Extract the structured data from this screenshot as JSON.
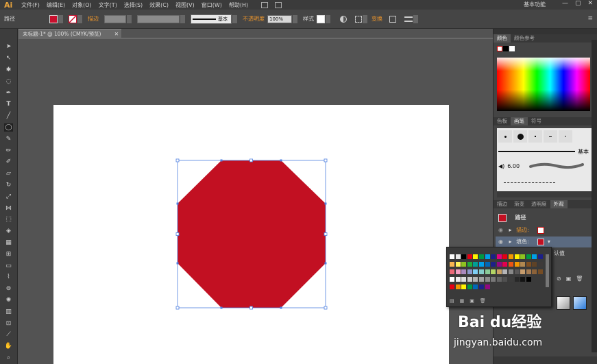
{
  "app": {
    "logo": "Ai",
    "workspace": "基本功能"
  },
  "menu": [
    "文件(F)",
    "编辑(E)",
    "对象(O)",
    "文字(T)",
    "选择(S)",
    "效果(C)",
    "视图(V)",
    "窗口(W)",
    "帮助(H)"
  ],
  "window_controls": [
    "—",
    "▢",
    "✕"
  ],
  "control_bar": {
    "selection_label": "路径",
    "stroke_label": "描边",
    "stroke_style": "基本",
    "opacity_label": "不透明度",
    "opacity_value": "100%",
    "style_label": "样式",
    "transform_label": "变换",
    "fill_color": "#c8102e"
  },
  "document": {
    "tab_title": "未标题-1* @ 100% (CMYK/预览)",
    "tab_close": "✕",
    "shape_fill": "#c21022",
    "selection_color": "#4f7fe0"
  },
  "panels": {
    "color_tabs": [
      "颜色",
      "颜色参考"
    ],
    "brush_tabs": [
      "色板",
      "画笔",
      "符号"
    ],
    "brush_basic": "基本",
    "brush_size": "6.00",
    "appearance_tabs": [
      "描边",
      "渐变",
      "透明度",
      "外观"
    ],
    "appearance": {
      "title": "路径",
      "stroke_label": "描边:",
      "fill_label": "填色:",
      "extra": "认值"
    }
  },
  "watermark": {
    "brand": "Bai du经验",
    "url": "jingyan.baidu.com"
  }
}
